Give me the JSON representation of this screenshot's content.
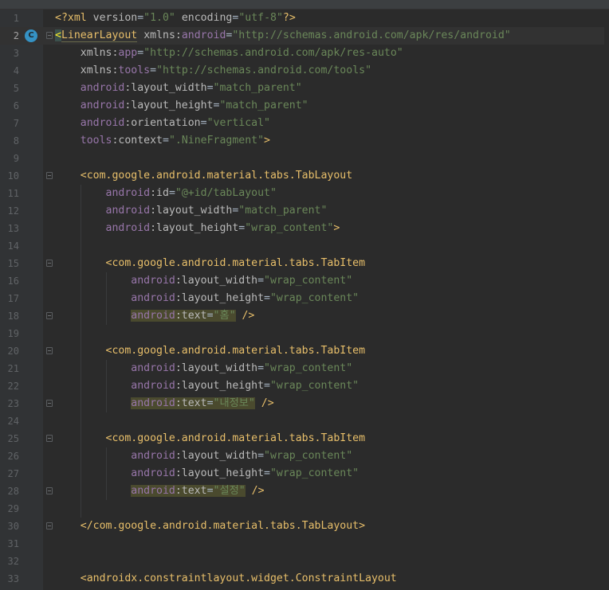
{
  "editor": {
    "current_line": 2,
    "class_marker_icon": "class-c-icon",
    "class_marker_letter": "C"
  },
  "colors": {
    "background": "#2b2b2b",
    "tag": "#e8bf6a",
    "namespace": "#9876aa",
    "value": "#6a8759",
    "text": "#a9b7c6"
  },
  "lines": [
    {
      "n": "1",
      "tokens": [
        [
          "pi",
          "<?xml "
        ],
        [
          "attr",
          "version"
        ],
        [
          "plain",
          "="
        ],
        [
          "val",
          "\"1.0\""
        ],
        [
          "plain",
          " "
        ],
        [
          "attr",
          "encoding"
        ],
        [
          "plain",
          "="
        ],
        [
          "val",
          "\"utf-8\""
        ],
        [
          "pi",
          "?>"
        ]
      ]
    },
    {
      "n": "2",
      "tokens": [
        [
          "match",
          "<"
        ],
        [
          "tag",
          "LinearLayout"
        ],
        [
          "plain",
          " "
        ],
        [
          "attr",
          "xmlns:"
        ],
        [
          "ns",
          "android"
        ],
        [
          "plain",
          "="
        ],
        [
          "val",
          "\"http://schemas.android.com/apk/res/android\""
        ]
      ]
    },
    {
      "n": "3",
      "tokens": [
        [
          "plain",
          "    "
        ],
        [
          "attr",
          "xmlns:"
        ],
        [
          "ns",
          "app"
        ],
        [
          "plain",
          "="
        ],
        [
          "val",
          "\"http://schemas.android.com/apk/res-auto\""
        ]
      ]
    },
    {
      "n": "4",
      "tokens": [
        [
          "plain",
          "    "
        ],
        [
          "attr",
          "xmlns:"
        ],
        [
          "ns",
          "tools"
        ],
        [
          "plain",
          "="
        ],
        [
          "val",
          "\"http://schemas.android.com/tools\""
        ]
      ]
    },
    {
      "n": "5",
      "tokens": [
        [
          "plain",
          "    "
        ],
        [
          "ns",
          "android"
        ],
        [
          "attr",
          ":layout_width"
        ],
        [
          "plain",
          "="
        ],
        [
          "val",
          "\"match_parent\""
        ]
      ]
    },
    {
      "n": "6",
      "tokens": [
        [
          "plain",
          "    "
        ],
        [
          "ns",
          "android"
        ],
        [
          "attr",
          ":layout_height"
        ],
        [
          "plain",
          "="
        ],
        [
          "val",
          "\"match_parent\""
        ]
      ]
    },
    {
      "n": "7",
      "tokens": [
        [
          "plain",
          "    "
        ],
        [
          "ns",
          "android"
        ],
        [
          "attr",
          ":orientation"
        ],
        [
          "plain",
          "="
        ],
        [
          "val",
          "\"vertical\""
        ]
      ]
    },
    {
      "n": "8",
      "tokens": [
        [
          "plain",
          "    "
        ],
        [
          "ns",
          "tools"
        ],
        [
          "attr",
          ":context"
        ],
        [
          "plain",
          "="
        ],
        [
          "val",
          "\".NineFragment\""
        ],
        [
          "tag",
          ">"
        ]
      ]
    },
    {
      "n": "9",
      "tokens": []
    },
    {
      "n": "10",
      "tokens": [
        [
          "plain",
          "    "
        ],
        [
          "tag",
          "<com.google.android.material.tabs.TabLayout"
        ]
      ]
    },
    {
      "n": "11",
      "tokens": [
        [
          "plain",
          "        "
        ],
        [
          "ns",
          "android"
        ],
        [
          "attr",
          ":id"
        ],
        [
          "plain",
          "="
        ],
        [
          "val",
          "\"@+id/tabLayout\""
        ]
      ]
    },
    {
      "n": "12",
      "tokens": [
        [
          "plain",
          "        "
        ],
        [
          "ns",
          "android"
        ],
        [
          "attr",
          ":layout_width"
        ],
        [
          "plain",
          "="
        ],
        [
          "val",
          "\"match_parent\""
        ]
      ]
    },
    {
      "n": "13",
      "tokens": [
        [
          "plain",
          "        "
        ],
        [
          "ns",
          "android"
        ],
        [
          "attr",
          ":layout_height"
        ],
        [
          "plain",
          "="
        ],
        [
          "val",
          "\"wrap_content\""
        ],
        [
          "tag",
          ">"
        ]
      ]
    },
    {
      "n": "14",
      "tokens": []
    },
    {
      "n": "15",
      "tokens": [
        [
          "plain",
          "        "
        ],
        [
          "tag",
          "<com.google.android.material.tabs.TabItem"
        ]
      ]
    },
    {
      "n": "16",
      "tokens": [
        [
          "plain",
          "            "
        ],
        [
          "ns",
          "android"
        ],
        [
          "attr",
          ":layout_width"
        ],
        [
          "plain",
          "="
        ],
        [
          "val",
          "\"wrap_content\""
        ]
      ]
    },
    {
      "n": "17",
      "tokens": [
        [
          "plain",
          "            "
        ],
        [
          "ns",
          "android"
        ],
        [
          "attr",
          ":layout_height"
        ],
        [
          "plain",
          "="
        ],
        [
          "val",
          "\"wrap_content\""
        ]
      ]
    },
    {
      "n": "18",
      "tokens": [
        [
          "plain",
          "            "
        ],
        [
          "hlns",
          "android"
        ],
        [
          "hlattr",
          ":text"
        ],
        [
          "hlplain",
          "="
        ],
        [
          "hlval",
          "\"홈\""
        ],
        [
          "plain",
          " "
        ],
        [
          "tag",
          "/>"
        ]
      ]
    },
    {
      "n": "19",
      "tokens": []
    },
    {
      "n": "20",
      "tokens": [
        [
          "plain",
          "        "
        ],
        [
          "tag",
          "<com.google.android.material.tabs.TabItem"
        ]
      ]
    },
    {
      "n": "21",
      "tokens": [
        [
          "plain",
          "            "
        ],
        [
          "ns",
          "android"
        ],
        [
          "attr",
          ":layout_width"
        ],
        [
          "plain",
          "="
        ],
        [
          "val",
          "\"wrap_content\""
        ]
      ]
    },
    {
      "n": "22",
      "tokens": [
        [
          "plain",
          "            "
        ],
        [
          "ns",
          "android"
        ],
        [
          "attr",
          ":layout_height"
        ],
        [
          "plain",
          "="
        ],
        [
          "val",
          "\"wrap_content\""
        ]
      ]
    },
    {
      "n": "23",
      "tokens": [
        [
          "plain",
          "            "
        ],
        [
          "hlns",
          "android"
        ],
        [
          "hlattr",
          ":text"
        ],
        [
          "hlplain",
          "="
        ],
        [
          "hlval",
          "\"내정보\""
        ],
        [
          "plain",
          " "
        ],
        [
          "tag",
          "/>"
        ]
      ]
    },
    {
      "n": "24",
      "tokens": []
    },
    {
      "n": "25",
      "tokens": [
        [
          "plain",
          "        "
        ],
        [
          "tag",
          "<com.google.android.material.tabs.TabItem"
        ]
      ]
    },
    {
      "n": "26",
      "tokens": [
        [
          "plain",
          "            "
        ],
        [
          "ns",
          "android"
        ],
        [
          "attr",
          ":layout_width"
        ],
        [
          "plain",
          "="
        ],
        [
          "val",
          "\"wrap_content\""
        ]
      ]
    },
    {
      "n": "27",
      "tokens": [
        [
          "plain",
          "            "
        ],
        [
          "ns",
          "android"
        ],
        [
          "attr",
          ":layout_height"
        ],
        [
          "plain",
          "="
        ],
        [
          "val",
          "\"wrap_content\""
        ]
      ]
    },
    {
      "n": "28",
      "tokens": [
        [
          "plain",
          "            "
        ],
        [
          "hlns",
          "android"
        ],
        [
          "hlattr",
          ":text"
        ],
        [
          "hlplain",
          "="
        ],
        [
          "hlval",
          "\"설정\""
        ],
        [
          "plain",
          " "
        ],
        [
          "tag",
          "/>"
        ]
      ]
    },
    {
      "n": "29",
      "tokens": []
    },
    {
      "n": "30",
      "tokens": [
        [
          "plain",
          "    "
        ],
        [
          "tag",
          "</com.google.android.material.tabs.TabLayout>"
        ]
      ]
    },
    {
      "n": "31",
      "tokens": []
    },
    {
      "n": "32",
      "tokens": []
    },
    {
      "n": "33",
      "tokens": [
        [
          "plain",
          "    "
        ],
        [
          "tag",
          "<androidx.constraintlayout.widget.ConstraintLayout"
        ]
      ]
    }
  ]
}
